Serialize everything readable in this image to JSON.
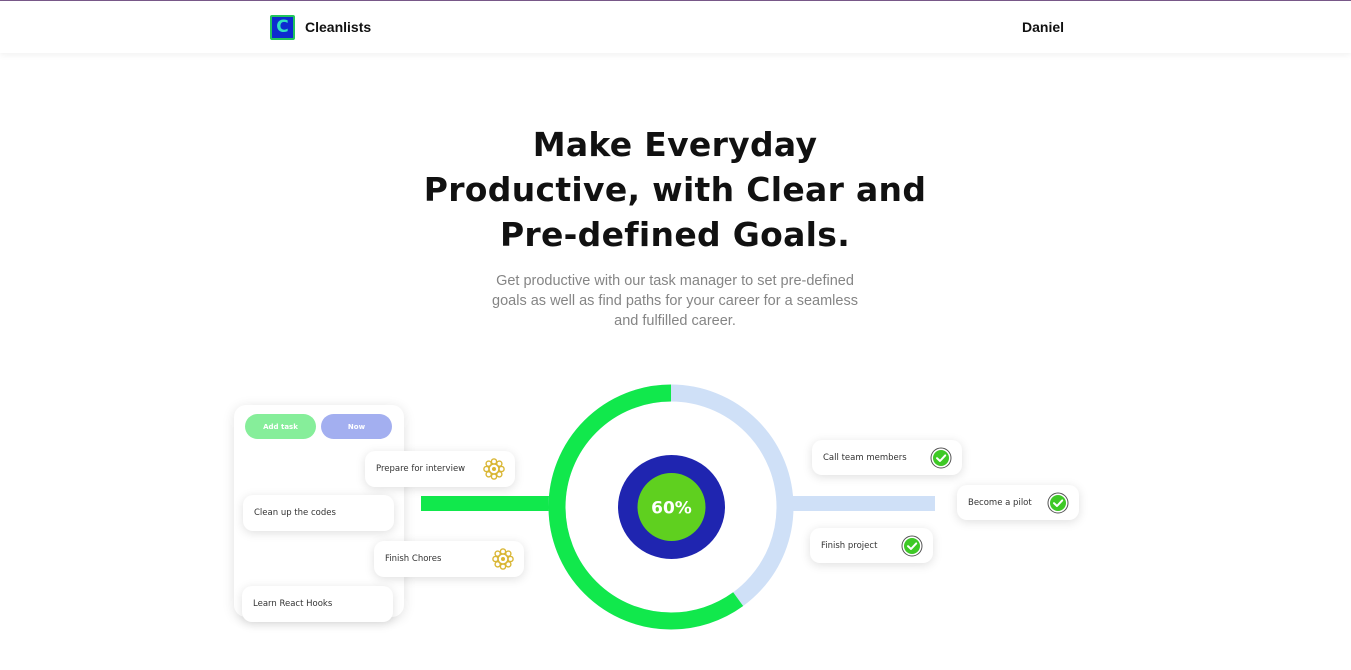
{
  "app": {
    "name": "Cleanlists",
    "logo_letter": "C",
    "user_name": "Daniel"
  },
  "hero": {
    "title": "Make Everyday Productive, with Clear and Pre-defined Goals.",
    "subtitle": "Get productive with our task manager to set pre-defined goals as well as find paths for your career for a seamless and fulfilled career."
  },
  "panel": {
    "add_task_label": "Add task",
    "now_label": "Now"
  },
  "tasks_pending": [
    {
      "label": "Prepare for interview",
      "icon": "gear-badge-icon"
    },
    {
      "label": "Clean up the codes"
    },
    {
      "label": "Finish Chores",
      "icon": "gear-badge-icon"
    },
    {
      "label": "Learn React Hooks"
    }
  ],
  "tasks_done": [
    {
      "label": "Call team members",
      "icon": "check-badge-icon"
    },
    {
      "label": "Become a pilot",
      "icon": "check-badge-icon"
    },
    {
      "label": "Finish project",
      "icon": "check-badge-icon"
    }
  ],
  "progress": {
    "value": 0.6,
    "label": "60%"
  },
  "colors": {
    "progress_done": "#11e84c",
    "progress_remaining": "#cfe0f7",
    "center_outer": "#1f25b0",
    "center_inner": "#5fd01f",
    "gear": "#d9b634",
    "check": "#3ec926"
  }
}
